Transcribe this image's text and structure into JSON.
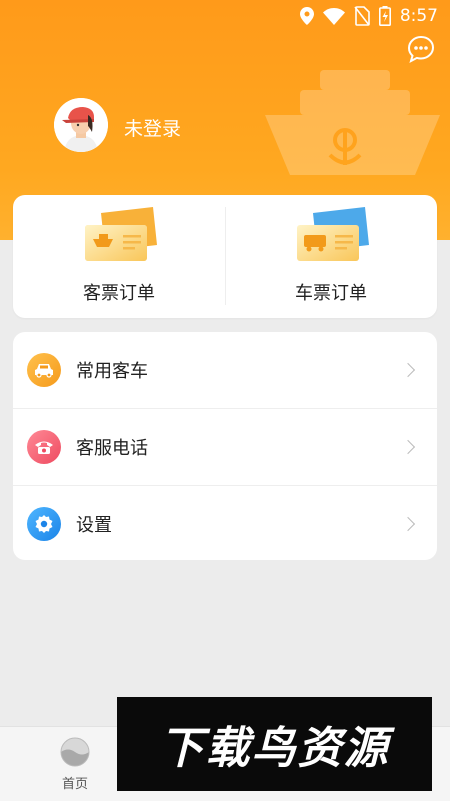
{
  "status_bar": {
    "time": "8:57",
    "icons": [
      "location-icon",
      "wifi-icon",
      "no-sim-icon",
      "battery-charging-icon"
    ]
  },
  "header": {
    "login_text": "未登录",
    "chat_icon": "chat-bubble-icon",
    "background_color": "#ff9a1a"
  },
  "tickets": [
    {
      "label": "客票订单",
      "icon": "ship-ticket-icon",
      "accent": "#f7b733"
    },
    {
      "label": "车票订单",
      "icon": "bus-ticket-icon",
      "accent": "#3aa0e8"
    }
  ],
  "menu": [
    {
      "label": "常用客车",
      "icon": "car-icon",
      "color": "#f5a623"
    },
    {
      "label": "客服电话",
      "icon": "phone-icon",
      "color": "#f0566b"
    },
    {
      "label": "设置",
      "icon": "gear-icon",
      "color": "#2196f3"
    }
  ],
  "tabbar": {
    "home_label": "首页"
  },
  "watermark": {
    "text": "下载鸟资源"
  }
}
